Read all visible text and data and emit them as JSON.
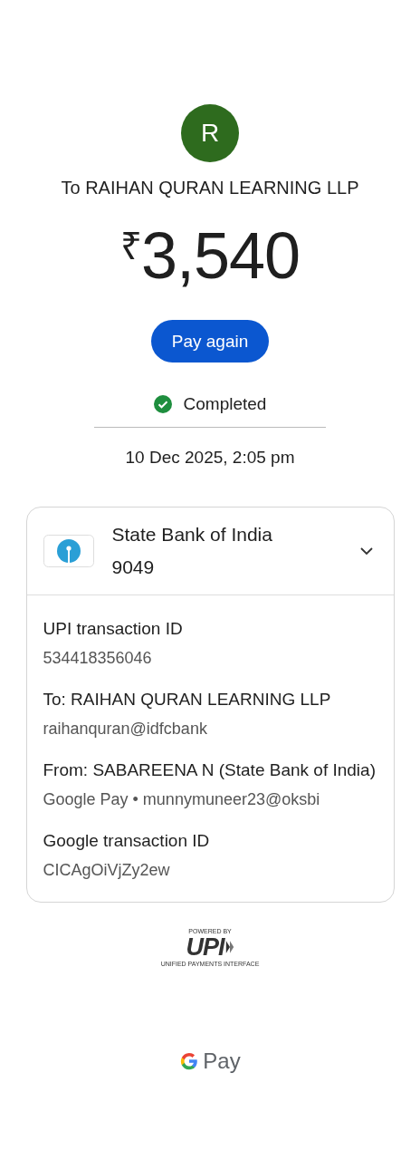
{
  "payee": {
    "initial": "R",
    "title": "To RAIHAN QURAN LEARNING LLP"
  },
  "amount": {
    "currency": "₹",
    "value": "3,540"
  },
  "button": "Pay again",
  "status": {
    "label": "Completed",
    "completed": true
  },
  "date": "10 Dec 2025, 2:05 pm",
  "account": {
    "bank": "State Bank of India",
    "number": "9049",
    "expanded": true
  },
  "details": [
    {
      "label": "UPI transaction ID",
      "lines": [
        "534418356046"
      ]
    },
    {
      "label": "To: RAIHAN QURAN LEARNING LLP",
      "lines": [
        "raihanquran@idfcbank"
      ]
    },
    {
      "label": "From: SABAREENA  N (State Bank of India)",
      "lines": [
        "Google Pay • munnymuneer23@oksbi"
      ]
    },
    {
      "label": "Google transaction ID",
      "lines": [
        "CICAgOiVjZy2ew"
      ]
    }
  ],
  "upi": {
    "powered_by": "POWERED BY",
    "logo": "UPI",
    "tagline": "UNIFIED PAYMENTS INTERFACE"
  },
  "footer": {
    "brand": "Pay"
  }
}
